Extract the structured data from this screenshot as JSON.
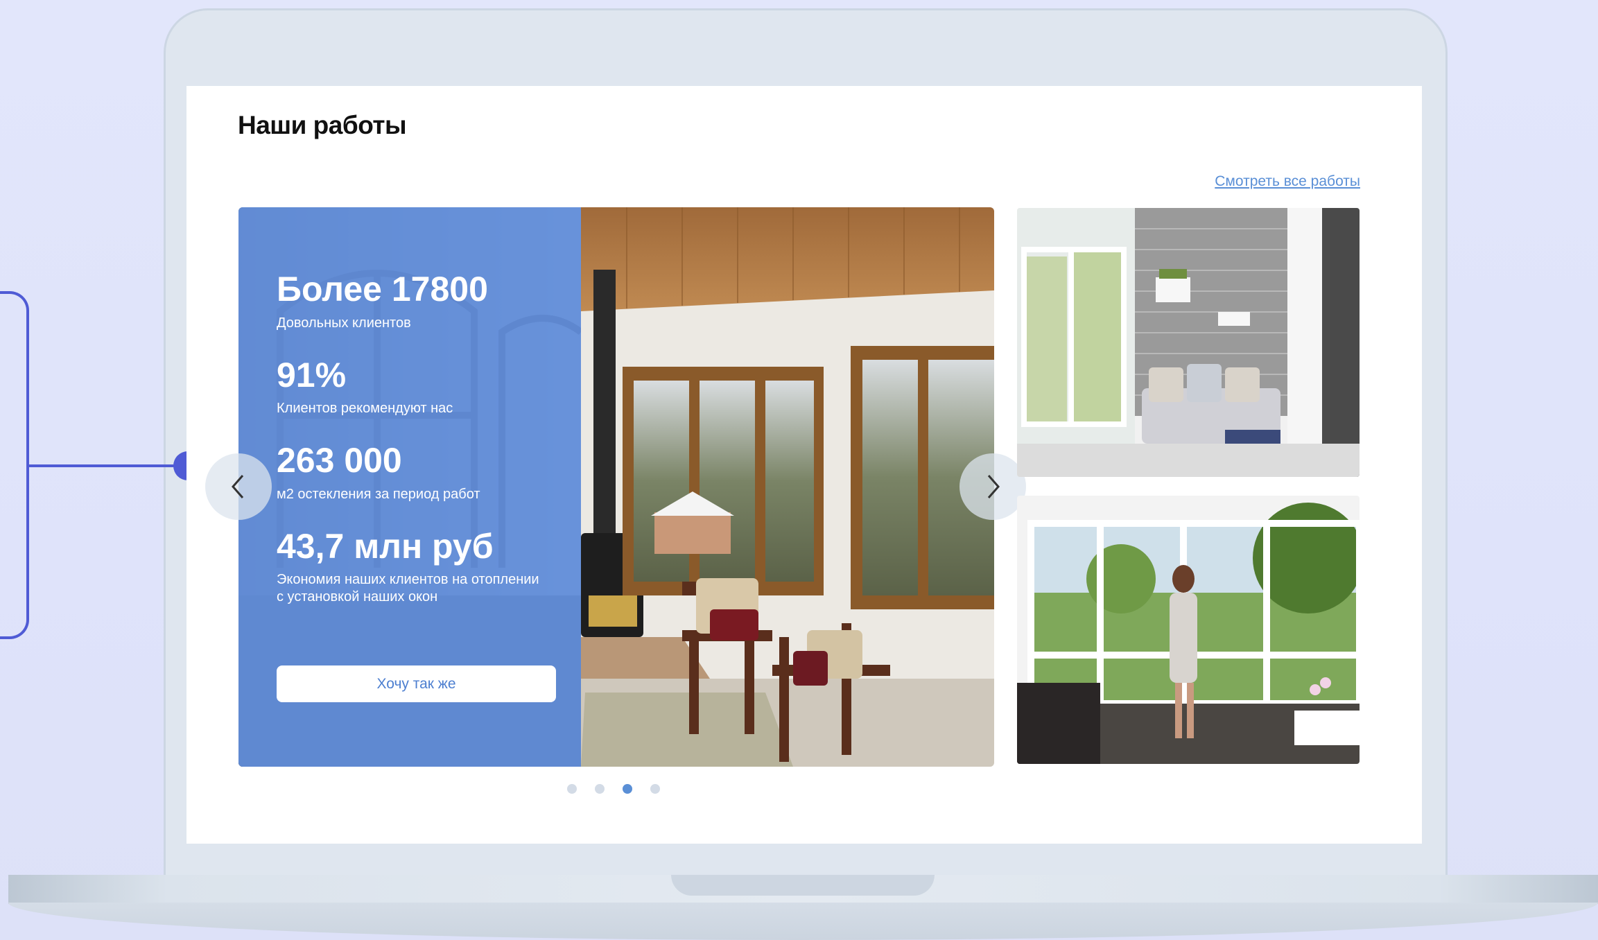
{
  "section": {
    "title": "Наши работы",
    "view_all_link": "Смотреть все работы"
  },
  "slider": {
    "stats": [
      {
        "value": "Более 17800",
        "label": "Довольных клиентов"
      },
      {
        "value": "91%",
        "label": "Клиентов рекомендуют нас"
      },
      {
        "value": "263 000",
        "label": "м2 остекления за период работ"
      },
      {
        "value": "43,7 млн руб",
        "label": "Экономия наших клиентов на отоплении с установкой наших окон"
      }
    ],
    "cta_label": "Хочу так же",
    "prev_icon": "chevron-left-icon",
    "next_icon": "chevron-right-icon",
    "pagination": {
      "total": 4,
      "active": 3
    }
  },
  "colors": {
    "overlay": "#6896e8",
    "accent": "#5a8fd6",
    "annotation": "#4f5bd5"
  }
}
